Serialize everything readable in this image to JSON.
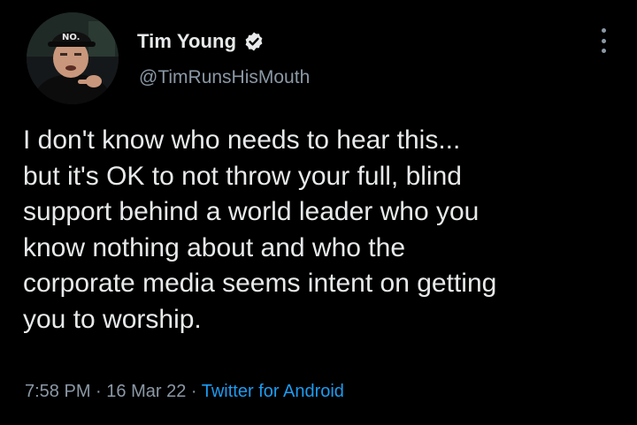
{
  "author": {
    "display_name": "Tim Young",
    "handle": "@TimRunsHisMouth",
    "verified": true,
    "verified_icon": "verified-badge-icon",
    "avatar_hat_text": "NO."
  },
  "tweet": {
    "text_lines": [
      "I don't know who needs to hear this...",
      "but it's OK to not throw your full, blind",
      "support behind a world leader who you",
      "know nothing about and who the",
      "corporate media seems intent on getting",
      "you to worship."
    ],
    "time": "7:58 PM",
    "separator": " · ",
    "date": "16 Mar 22",
    "source": "Twitter for Android"
  },
  "colors": {
    "background": "#000000",
    "text": "#e7e9ea",
    "secondary": "#8b98a5",
    "link": "#1d9bf0"
  }
}
